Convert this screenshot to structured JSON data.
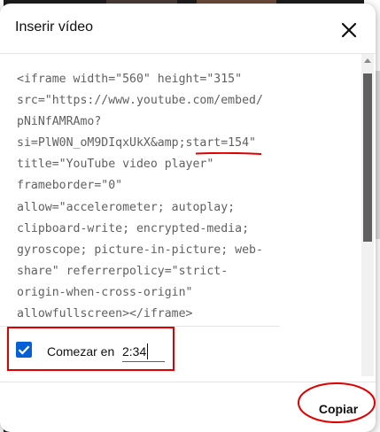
{
  "dialog": {
    "title": "Inserir vídeo"
  },
  "embed_code": {
    "lines": [
      "<iframe width=\"560\" height=\"315\"",
      "src=\"https://www.youtube.com/embed/",
      "pNiNfAMRAmo?",
      "si=PlW0N_oM9DIqxUkX&amp;start=154\"",
      "title=\"YouTube video player\"",
      "frameborder=\"0\"",
      "allow=\"accelerometer; autoplay;",
      "clipboard-write; encrypted-media;",
      "gyroscope; picture-in-picture; web-",
      "share\" referrerpolicy=\"strict-",
      "origin-when-cross-origin\"",
      "allowfullscreen></iframe>"
    ]
  },
  "start_at": {
    "checked": true,
    "label": "Comezar en",
    "value": "2:34"
  },
  "actions": {
    "copy_label": "Copiar"
  },
  "colors": {
    "accent": "#065fd4",
    "annotation": "#e00000"
  },
  "icons": {
    "close": "close-icon",
    "checkbox": "check-icon"
  }
}
